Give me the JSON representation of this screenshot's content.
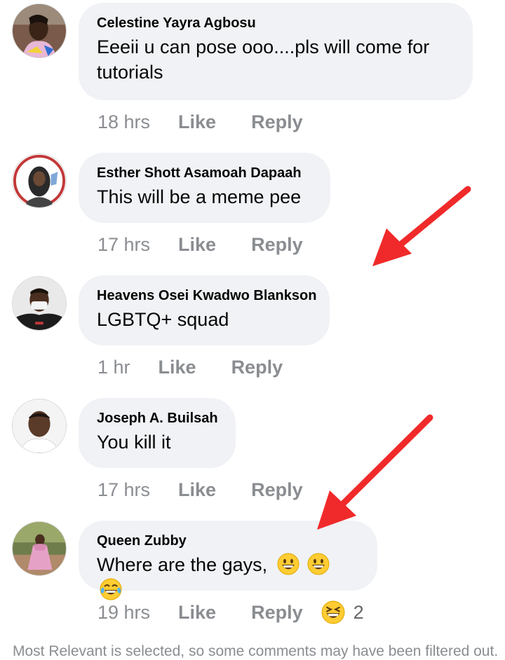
{
  "comments": [
    {
      "author": "Celestine Yayra Agbosu",
      "text": "Eeeii u can pose ooo....pls will come for tutorials",
      "time": "18 hrs",
      "like_label": "Like",
      "reply_label": "Reply"
    },
    {
      "author": "Esther Shott Asamoah Dapaah",
      "text": "This will be a meme pee",
      "time": "17 hrs",
      "like_label": "Like",
      "reply_label": "Reply"
    },
    {
      "author": "Heavens Osei Kwadwo Blankson",
      "text": "LGBTQ+ squad",
      "time": "1 hr",
      "like_label": "Like",
      "reply_label": "Reply"
    },
    {
      "author": "Joseph A. Builsah",
      "text": "You kill it",
      "time": "17 hrs",
      "like_label": "Like",
      "reply_label": "Reply"
    },
    {
      "author": "Queen Zubby",
      "text": "Where are the gays,",
      "time": "19 hrs",
      "like_label": "Like",
      "reply_label": "Reply",
      "reaction_count": "2"
    }
  ],
  "footer_note": "Most Relevant is selected, so some comments may have been filtered out.",
  "icons": {
    "arrow_color": "#f02a2a",
    "emoji_grin": "grinning-face-icon",
    "emoji_laugh": "tears-of-joy-icon",
    "emoji_squint": "squinting-face-icon"
  }
}
